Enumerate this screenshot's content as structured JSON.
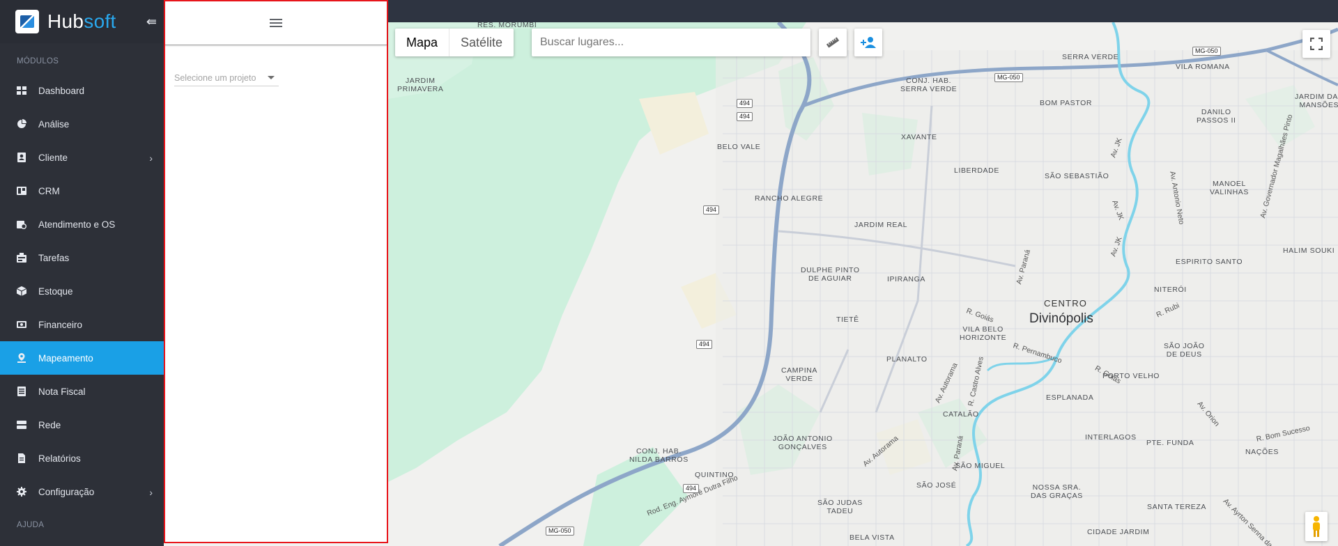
{
  "brand": {
    "name_main": "Hub",
    "name_accent": "soft"
  },
  "sidebar": {
    "section_modules": "MÓDULOS",
    "section_help": "AJUDA",
    "items": [
      {
        "label": "Dashboard",
        "icon": "dashboard-icon"
      },
      {
        "label": "Análise",
        "icon": "pie-chart-icon"
      },
      {
        "label": "Cliente",
        "icon": "contact-card-icon",
        "has_submenu": true
      },
      {
        "label": "CRM",
        "icon": "board-icon"
      },
      {
        "label": "Atendimento e OS",
        "icon": "calendar-clock-icon"
      },
      {
        "label": "Tarefas",
        "icon": "task-board-icon"
      },
      {
        "label": "Estoque",
        "icon": "package-icon"
      },
      {
        "label": "Financeiro",
        "icon": "money-icon"
      },
      {
        "label": "Mapeamento",
        "icon": "map-pin-icon",
        "active": true
      },
      {
        "label": "Nota Fiscal",
        "icon": "receipt-icon"
      },
      {
        "label": "Rede",
        "icon": "server-icon"
      },
      {
        "label": "Relatórios",
        "icon": "document-icon"
      },
      {
        "label": "Configuração",
        "icon": "gear-icon",
        "has_submenu": true
      }
    ]
  },
  "panel": {
    "project_select_placeholder": "Selecione um projeto"
  },
  "map": {
    "type_map": "Mapa",
    "type_satellite": "Satélite",
    "search_placeholder": "Buscar lugares...",
    "labels": {
      "res_morumbi": "RES. MORUMBI",
      "jardim_primavera": "JARDIM\nPRIMAVERA",
      "conj_hab_serra_verde": "CONJ. HAB.\nSERRA VERDE",
      "serra_verde": "SERRA VERDE",
      "vila_romana": "VILA ROMANA",
      "jardim_das_mansoes": "JARDIM DAS\nMANSÕES",
      "bom_pastor": "BOM PASTOR",
      "danilo_passos_ii": "DANILO\nPASSOS II",
      "xavante": "XAVANTE",
      "belo_vale": "BELO VALE",
      "liberdade": "LIBERDADE",
      "sao_sebastiao": "SÃO SEBASTIÃO",
      "manoel_valinhas": "MANOEL\nVALINHAS",
      "rancho_alegre": "RANCHO ALEGRE",
      "jardim_real": "JARDIM REAL",
      "halim_souki": "HALIM SOUKI",
      "espirito_santo": "ESPIRITO SANTO",
      "dulphe_pinto": "DULPHE PINTO\nDE AGUIAR",
      "ipiranga": "IPIRANGA",
      "niteroi": "NITERÓI",
      "centro": "CENTRO",
      "divinopolis": "Divinópolis",
      "tiete": "TIETÊ",
      "vila_belo_horizonte": "VILA BELO\nHORIZONTE",
      "sao_joao_de_deus": "SÃO JOÃO\nDE DEUS",
      "planalto": "PLANALTO",
      "campina_verde": "CAMPINA\nVERDE",
      "porto_velho": "PORTO VELHO",
      "esplanada": "ESPLANADA",
      "catalao": "CATALÃO",
      "joao_antonio": "JOÃO ANTONIO\nGONÇALVES",
      "interlagos": "INTERLAGOS",
      "pte_funda": "PTE. FUNDA",
      "nacoes": "NAÇÕES",
      "conj_hab_nilda": "CONJ. HAB.\nNILDA BARROS",
      "sao_miguel": "SÃO MIGUEL",
      "quintino": "QUINTINO",
      "sao_jose": "SÃO JOSÉ",
      "nossa_sra_gracas": "NOSSA SRA.\nDAS GRAÇAS",
      "santa_tereza": "SANTA TEREZA",
      "sao_judas_tadeu": "SÃO JUDAS\nTADEU",
      "bela_vista": "BELA VISTA",
      "cidade_jardim": "CIDADE JARDIM"
    },
    "streets": {
      "av_jk_1": "Av. JK",
      "av_jk_2": "Av. JK",
      "av_jk_3": "Av. JK",
      "av_antonio_neto": "Av. Antonio Neto",
      "av_gov_magalhaes": "Av. Governador Magalhães Pinto",
      "av_parana_1": "Av. Paraná",
      "r_goias_1": "R. Goiás",
      "r_pernambuco": "R. Pernambuco",
      "r_rubi": "R. Rubi",
      "r_goias_2": "R. Goiás",
      "av_autorama_1": "Av. Autorama",
      "r_castro_alves": "R. Castro Alves",
      "av_orion": "Av. Orion",
      "r_bom_sucesso": "R. Bom Sucesso",
      "av_autorama_2": "Av. Autorama",
      "av_parana_2": "Av. Paraná",
      "rod_eng": "Rod. Eng. Aymoré Dutra Filho",
      "av_ayrton": "Av. Ayrton Senna da"
    },
    "shields": {
      "mg050_a": "MG-050",
      "mg050_b": "MG-050",
      "mg050_c": "MG-050",
      "r494_a": "494",
      "r494_b": "494",
      "r494_c": "494",
      "r494_d": "494",
      "r494_e": "494"
    }
  }
}
